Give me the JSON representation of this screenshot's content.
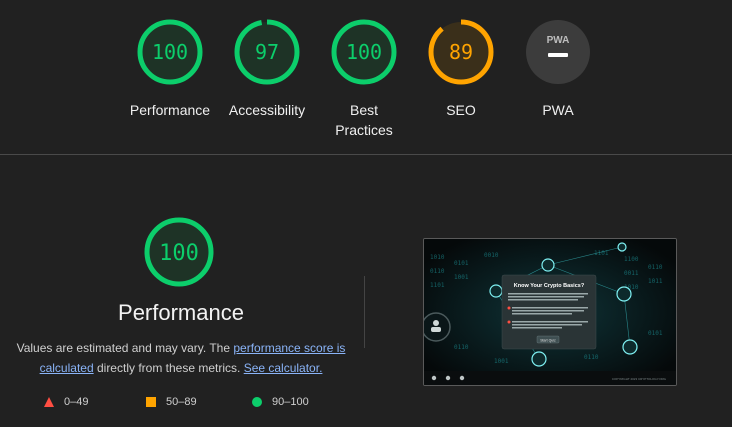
{
  "gauges": [
    {
      "score": "100",
      "label_line1": "Performance",
      "label_line2": "",
      "color": "#0cce6b",
      "fill": 1.0
    },
    {
      "score": "97",
      "label_line1": "Accessibility",
      "label_line2": "",
      "color": "#0cce6b",
      "fill": 0.97
    },
    {
      "score": "100",
      "label_line1": "Best",
      "label_line2": "Practices",
      "color": "#0cce6b",
      "fill": 1.0
    },
    {
      "score": "89",
      "label_line1": "SEO",
      "label_line2": "",
      "color": "#ffa400",
      "fill": 0.89
    },
    {
      "score": "",
      "label_line1": "PWA",
      "label_line2": "",
      "color": "#9e9e9e",
      "fill": 0
    }
  ],
  "pwa_badge": "PWA",
  "performance": {
    "score": "100",
    "title": "Performance",
    "desc_prefix": "Values are estimated and may vary. The ",
    "link_score": "performance score is calculated",
    "desc_mid": " directly from these metrics. ",
    "link_calculator": "See calculator."
  },
  "legend": [
    {
      "icon": "triangle-icon",
      "range": "0–49",
      "color": "#ff4e42"
    },
    {
      "icon": "square-icon",
      "range": "50–89",
      "color": "#ffa400"
    },
    {
      "icon": "circle-icon",
      "range": "90–100",
      "color": "#0cce6b"
    }
  ],
  "thumbnail": {
    "dialog_title": "Know Your Crypto Basics?",
    "dialog_button": "Start Quiz",
    "footer": "COPYRIGHT 2023 CRYPTOLOGY.ORG"
  },
  "colors": {
    "pass": "#0cce6b",
    "average": "#ffa400",
    "fail": "#ff4e42",
    "link": "#8ab4f8",
    "background": "#212121"
  }
}
